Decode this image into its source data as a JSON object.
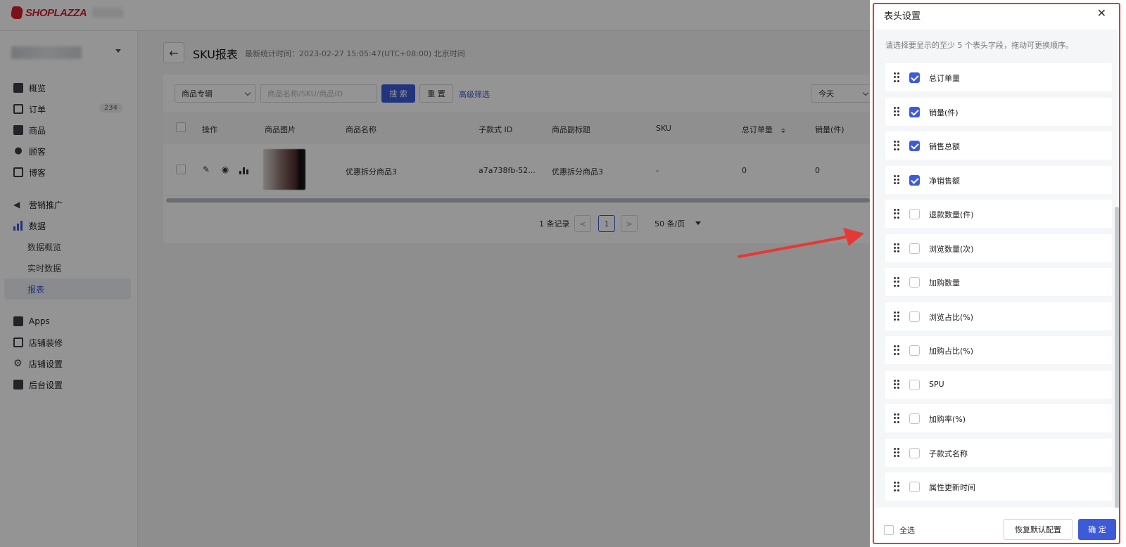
{
  "brand": {
    "logo_text": "SHOPLAZZA"
  },
  "sidebar": {
    "items": [
      {
        "label": "概览",
        "icon": "overview-icon"
      },
      {
        "label": "订单",
        "icon": "inbox-icon",
        "badge": "234"
      },
      {
        "label": "商品",
        "icon": "bag-icon"
      },
      {
        "label": "顾客",
        "icon": "user-icon"
      },
      {
        "label": "博客",
        "icon": "blog-icon"
      },
      {
        "label": "营销推广",
        "icon": "megaphone-icon"
      },
      {
        "label": "数据",
        "icon": "bar-chart-icon"
      },
      {
        "label": "数据概览",
        "icon": ""
      },
      {
        "label": "实时数据",
        "icon": ""
      },
      {
        "label": "报表",
        "icon": ""
      },
      {
        "label": "Apps",
        "icon": "apps-icon"
      },
      {
        "label": "店铺装修",
        "icon": "store-icon"
      },
      {
        "label": "店铺设置",
        "icon": "gear-icon"
      },
      {
        "label": "后台设置",
        "icon": "server-icon"
      }
    ]
  },
  "header": {
    "title": "SKU报表",
    "subtitle": "最新统计时间：2023-02-27 15:05:47(UTC+08:00) 北京时间"
  },
  "filters": {
    "category_select": "商品专辑",
    "search_placeholder": "商品名称/SKU/商品ID",
    "search_button": "搜 索",
    "reset_button": "重 置",
    "advanced_link": "高级筛选",
    "date_select": "今天"
  },
  "table": {
    "columns": [
      "操作",
      "商品图片",
      "商品名称",
      "子款式 ID",
      "商品副标题",
      "SKU",
      "总订单量",
      "销量(件)"
    ],
    "rows": [
      {
        "name": "优惠拆分商品3",
        "variant_id": "a7a738fb-52...",
        "subtitle": "优惠拆分商品3",
        "sku": "-",
        "orders": "0",
        "sales": "0"
      }
    ]
  },
  "pagination": {
    "count": "1 条记录",
    "prev": "<",
    "page": "1",
    "next": ">",
    "page_size": "50 条/页"
  },
  "drawer": {
    "title": "表头设置",
    "close": "✕",
    "tip": "请选择要显示的至少 5 个表头字段，拖动可更换顺序。",
    "fields": [
      {
        "label": "总订单量",
        "checked": true
      },
      {
        "label": "销量(件)",
        "checked": true
      },
      {
        "label": "销售总额",
        "checked": true
      },
      {
        "label": "净销售额",
        "checked": true
      },
      {
        "label": "退款数量(件)",
        "checked": false
      },
      {
        "label": "浏览数量(次)",
        "checked": false
      },
      {
        "label": "加购数量",
        "checked": false
      },
      {
        "label": "浏览占比(%)",
        "checked": false
      },
      {
        "label": "加购占比(%)",
        "checked": false
      },
      {
        "label": "SPU",
        "checked": false
      },
      {
        "label": "加购率(%)",
        "checked": false
      },
      {
        "label": "子款式名称",
        "checked": false
      },
      {
        "label": "属性更新时间",
        "checked": false
      }
    ],
    "select_all": "全选",
    "restore_button": "恢复默认配置",
    "confirm_button": "确 定"
  },
  "colors": {
    "accent": "#3d5bd9",
    "brand": "#d81e2c",
    "highlight": "#e53935"
  }
}
